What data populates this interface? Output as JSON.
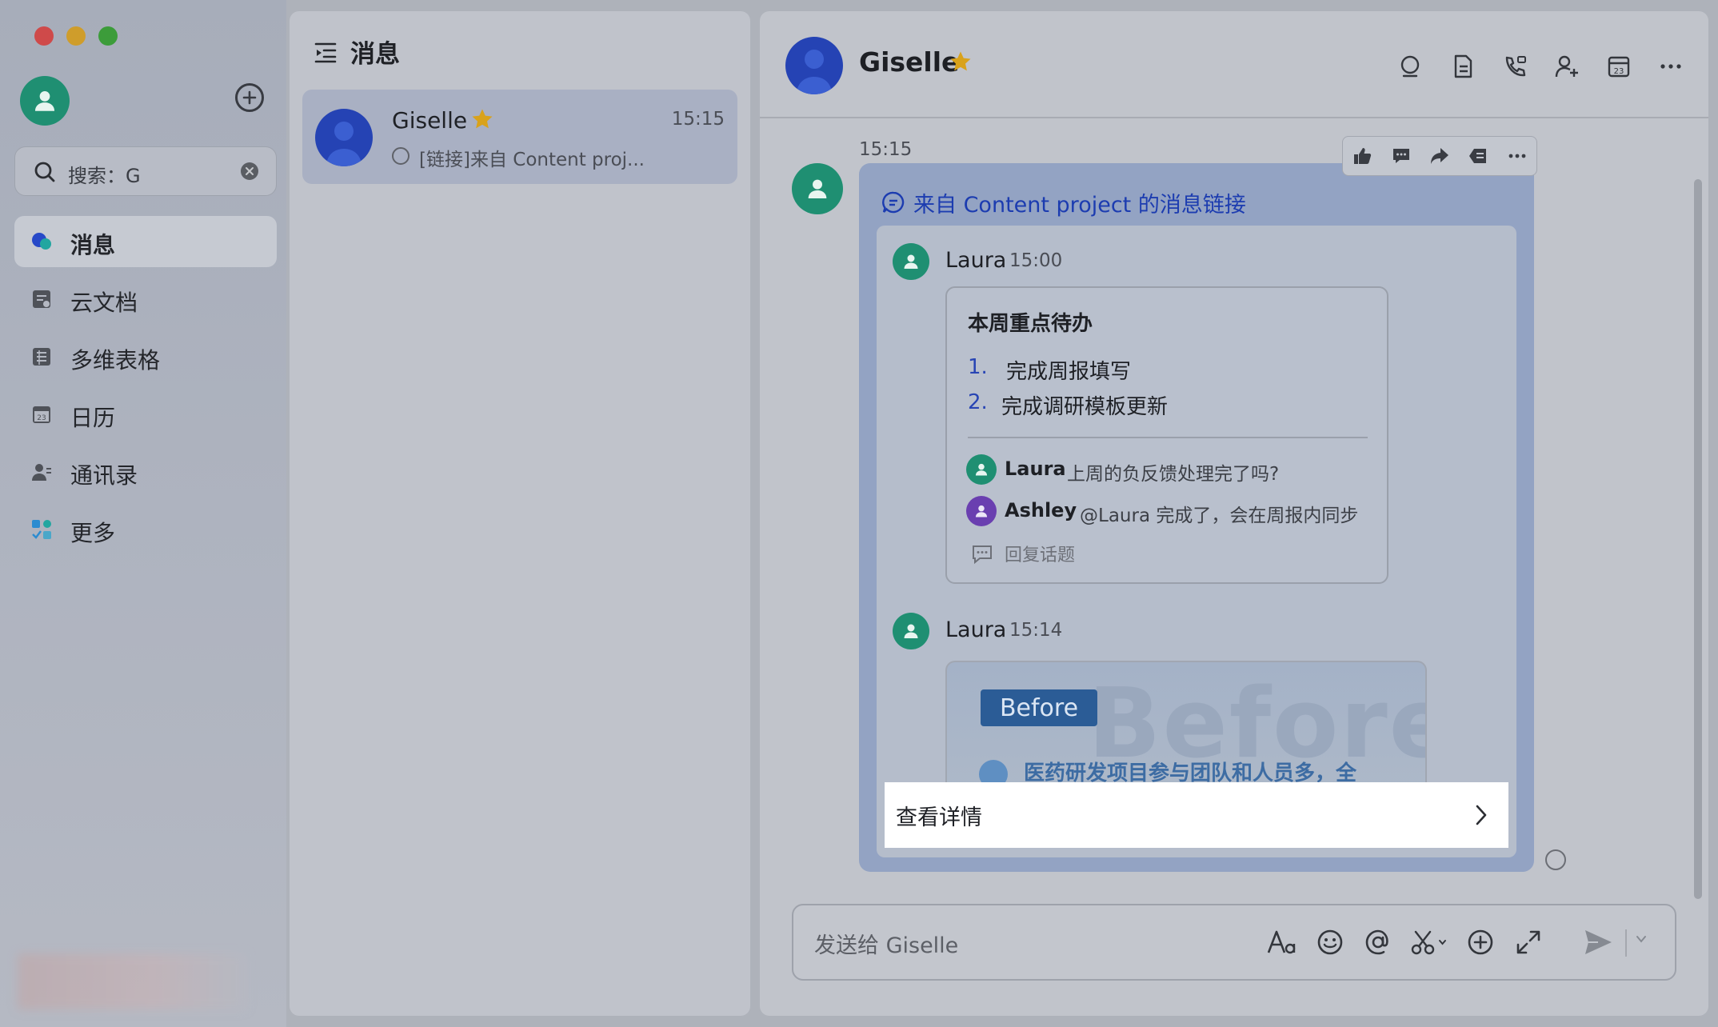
{
  "sidebar": {
    "search": {
      "text": "搜索：G"
    },
    "nav": [
      {
        "label": "消息",
        "active": true
      },
      {
        "label": "云文档"
      },
      {
        "label": "多维表格"
      },
      {
        "label": "日历"
      },
      {
        "label": "通讯录"
      },
      {
        "label": "更多"
      }
    ]
  },
  "list": {
    "title": "消息",
    "chats": [
      {
        "name": "Giselle",
        "time": "15:15",
        "preview": "[链接]来自 Content proj..."
      }
    ]
  },
  "chat": {
    "header": {
      "name": "Giselle"
    },
    "message": {
      "time": "15:15",
      "link_title": "来自 Content project 的消息链接",
      "quoted": [
        {
          "sender": "Laura",
          "time": "15:00",
          "card": {
            "title": "本周重点待办",
            "items": [
              {
                "num": "1.",
                "text": "完成周报填写"
              },
              {
                "num": "2.",
                "text": "完成调研模板更新"
              }
            ],
            "comments": [
              {
                "name": "Laura",
                "text": "上周的负反馈处理完了吗?",
                "avatar_color": "#1f8f72"
              },
              {
                "name": "Ashley",
                "text": "@Laura 完成了，会在周报内同步",
                "avatar_color": "#6a3fb0"
              }
            ],
            "reply_label": "回复话题"
          }
        },
        {
          "sender": "Laura",
          "time": "15:14",
          "image": {
            "badge": "Before",
            "background_text": "Before",
            "line": "医药研发项目参与团队和人员多，全"
          }
        }
      ],
      "detail_label": "查看详情"
    },
    "composer": {
      "placeholder": "发送给 Giselle"
    }
  },
  "colors": {
    "accent": "#1c3cb0",
    "avatar_green": "#1f8f72",
    "avatar_blue": "#2543b4",
    "star": "#d9a21b"
  }
}
